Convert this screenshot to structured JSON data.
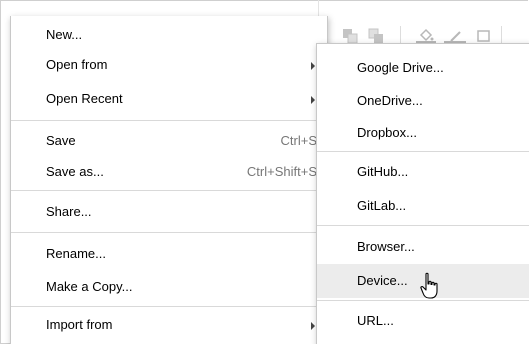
{
  "file_menu": {
    "items": [
      {
        "label": "New...",
        "shortcut": "",
        "submenu": false
      },
      {
        "label": "Open from",
        "shortcut": "",
        "submenu": true
      },
      {
        "label": "Open Recent",
        "shortcut": "",
        "submenu": true
      },
      {
        "label": "Save",
        "shortcut": "Ctrl+S",
        "submenu": false
      },
      {
        "label": "Save as...",
        "shortcut": "Ctrl+Shift+S",
        "submenu": false
      },
      {
        "label": "Share...",
        "shortcut": "",
        "submenu": false
      },
      {
        "label": "Rename...",
        "shortcut": "",
        "submenu": false
      },
      {
        "label": "Make a Copy...",
        "shortcut": "",
        "submenu": false
      },
      {
        "label": "Import from",
        "shortcut": "",
        "submenu": true
      }
    ]
  },
  "open_from_submenu": {
    "items": [
      {
        "label": "Google Drive..."
      },
      {
        "label": "OneDrive..."
      },
      {
        "label": "Dropbox..."
      },
      {
        "label": "GitHub..."
      },
      {
        "label": "GitLab..."
      },
      {
        "label": "Browser..."
      },
      {
        "label": "Device..."
      },
      {
        "label": "URL..."
      }
    ],
    "hovered_item": "Device..."
  },
  "toolbar_icons": [
    "to-front-icon",
    "to-back-icon",
    "fill-color-icon",
    "line-color-icon",
    "shadow-icon"
  ],
  "colors": {
    "menu_bg": "#ffffff",
    "menu_border": "#c8c8c8",
    "divider": "#d9d9d9",
    "hover_bg": "#ececec",
    "shortcut_text": "#777777",
    "toolbar_icon": "#b8b8b8"
  }
}
